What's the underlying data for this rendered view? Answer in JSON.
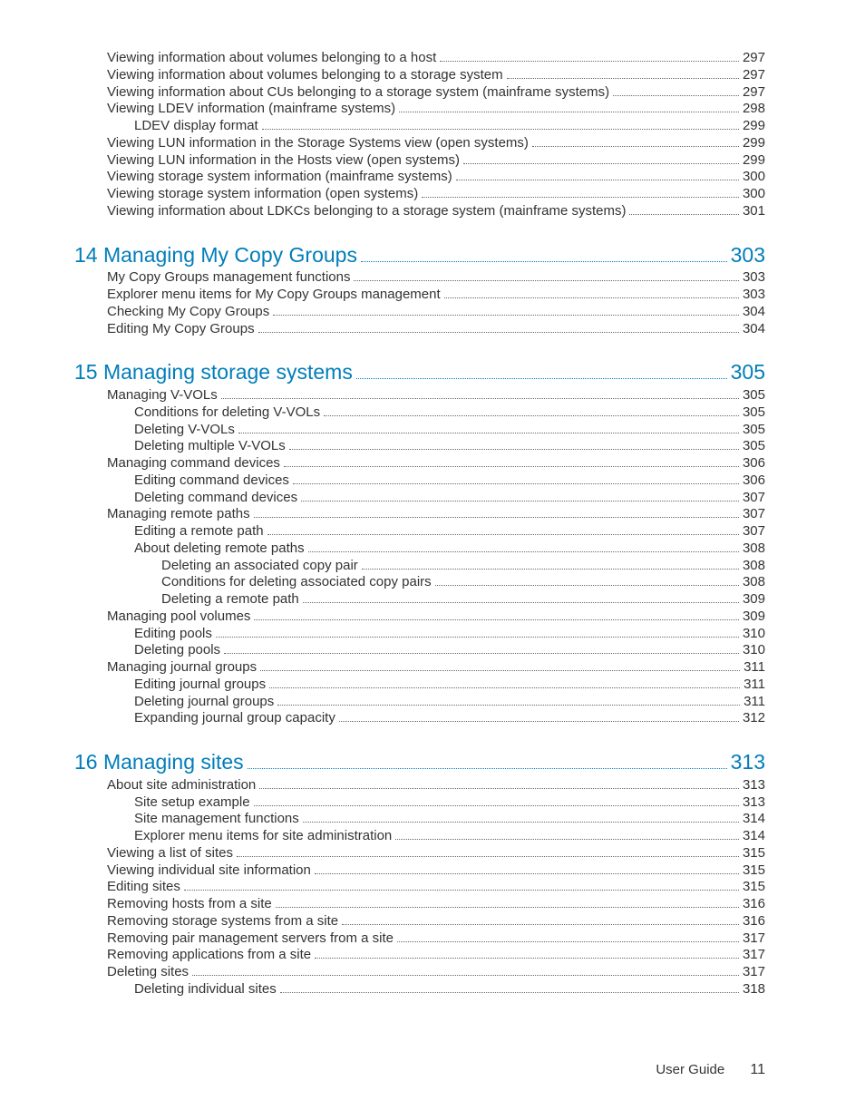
{
  "footer": {
    "label": "User Guide",
    "page": "11"
  },
  "entries": [
    {
      "level": 1,
      "title": "Viewing information about volumes belonging to a host",
      "page": "297"
    },
    {
      "level": 1,
      "title": "Viewing information about volumes belonging to a storage system",
      "page": "297"
    },
    {
      "level": 1,
      "title": "Viewing information about CUs belonging to a storage system (mainframe systems)",
      "page": "297"
    },
    {
      "level": 1,
      "title": "Viewing LDEV information (mainframe systems)",
      "page": "298"
    },
    {
      "level": 2,
      "title": "LDEV display format",
      "page": "299"
    },
    {
      "level": 1,
      "title": "Viewing LUN information in the Storage Systems view (open systems)",
      "page": "299"
    },
    {
      "level": 1,
      "title": "Viewing LUN information in the Hosts view (open systems)",
      "page": "299"
    },
    {
      "level": 1,
      "title": "Viewing storage system information (mainframe systems)",
      "page": "300"
    },
    {
      "level": 1,
      "title": "Viewing storage system information (open systems)",
      "page": "300"
    },
    {
      "level": 1,
      "title": "Viewing information about LDKCs belonging to a storage system (mainframe systems)",
      "page": "301"
    },
    {
      "level": 0,
      "title": "14 Managing My Copy Groups",
      "page": "303"
    },
    {
      "level": 1,
      "title": "My Copy Groups management functions",
      "page": "303"
    },
    {
      "level": 1,
      "title": "Explorer menu items for My Copy Groups management",
      "page": "303"
    },
    {
      "level": 1,
      "title": "Checking My Copy Groups",
      "page": "304"
    },
    {
      "level": 1,
      "title": "Editing My Copy Groups",
      "page": "304"
    },
    {
      "level": 0,
      "title": "15 Managing storage systems",
      "page": "305"
    },
    {
      "level": 1,
      "title": "Managing V-VOLs",
      "page": "305"
    },
    {
      "level": 2,
      "title": "Conditions for deleting V-VOLs",
      "page": "305"
    },
    {
      "level": 2,
      "title": "Deleting V-VOLs",
      "page": "305"
    },
    {
      "level": 2,
      "title": "Deleting multiple V-VOLs",
      "page": "305"
    },
    {
      "level": 1,
      "title": "Managing command devices",
      "page": "306"
    },
    {
      "level": 2,
      "title": "Editing command devices",
      "page": "306"
    },
    {
      "level": 2,
      "title": "Deleting command devices",
      "page": "307"
    },
    {
      "level": 1,
      "title": "Managing remote paths",
      "page": "307"
    },
    {
      "level": 2,
      "title": "Editing a remote path",
      "page": "307"
    },
    {
      "level": 2,
      "title": "About deleting remote paths",
      "page": "308"
    },
    {
      "level": 3,
      "title": "Deleting an associated copy pair",
      "page": "308"
    },
    {
      "level": 3,
      "title": "Conditions for deleting associated copy pairs",
      "page": "308"
    },
    {
      "level": 3,
      "title": "Deleting a remote path",
      "page": "309"
    },
    {
      "level": 1,
      "title": "Managing pool volumes",
      "page": "309"
    },
    {
      "level": 2,
      "title": "Editing pools",
      "page": "310"
    },
    {
      "level": 2,
      "title": "Deleting pools",
      "page": "310"
    },
    {
      "level": 1,
      "title": "Managing journal groups",
      "page": "311"
    },
    {
      "level": 2,
      "title": "Editing journal groups",
      "page": "311"
    },
    {
      "level": 2,
      "title": "Deleting journal groups",
      "page": "311"
    },
    {
      "level": 2,
      "title": "Expanding journal group capacity",
      "page": "312"
    },
    {
      "level": 0,
      "title": "16 Managing sites",
      "page": "313"
    },
    {
      "level": 1,
      "title": "About site administration",
      "page": "313"
    },
    {
      "level": 2,
      "title": "Site setup example",
      "page": "313"
    },
    {
      "level": 2,
      "title": "Site management functions",
      "page": "314"
    },
    {
      "level": 2,
      "title": "Explorer menu items for site administration",
      "page": "314"
    },
    {
      "level": 1,
      "title": "Viewing a list of sites",
      "page": "315"
    },
    {
      "level": 1,
      "title": "Viewing individual site information",
      "page": "315"
    },
    {
      "level": 1,
      "title": "Editing sites",
      "page": "315"
    },
    {
      "level": 1,
      "title": "Removing hosts from a site",
      "page": "316"
    },
    {
      "level": 1,
      "title": "Removing storage systems from a site",
      "page": "316"
    },
    {
      "level": 1,
      "title": "Removing pair management servers from a site",
      "page": "317"
    },
    {
      "level": 1,
      "title": "Removing applications from a site",
      "page": "317"
    },
    {
      "level": 1,
      "title": "Deleting sites",
      "page": "317"
    },
    {
      "level": 2,
      "title": "Deleting individual sites",
      "page": "318"
    }
  ]
}
